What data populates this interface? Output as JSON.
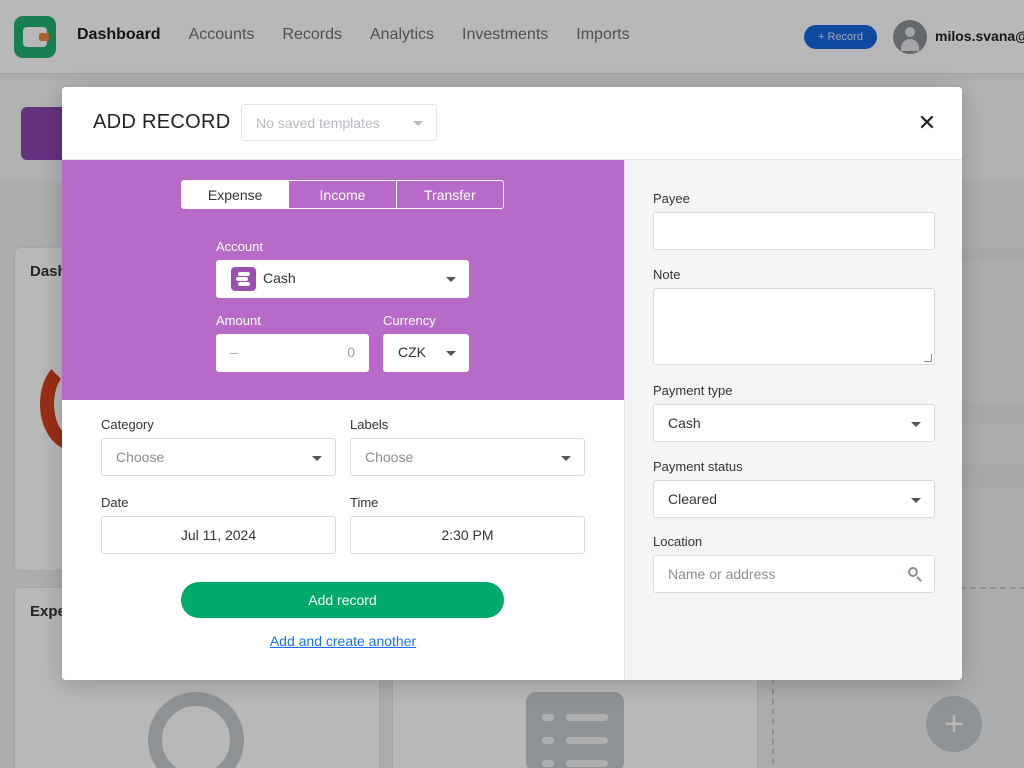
{
  "topbar": {
    "nav": [
      "Dashboard",
      "Accounts",
      "Records",
      "Analytics",
      "Investments",
      "Imports"
    ],
    "record_button": "+ Record",
    "username": "milos.svana@"
  },
  "background": {
    "card1_title": "Dash",
    "card2_title": "Expe"
  },
  "modal": {
    "title": "ADD RECORD",
    "templates_placeholder": "No saved templates",
    "close_label": "✕",
    "tabs": [
      {
        "label": "Expense",
        "active": true
      },
      {
        "label": "Income",
        "active": false
      },
      {
        "label": "Transfer",
        "active": false
      }
    ],
    "account": {
      "label": "Account",
      "value": "Cash",
      "icon": "coins-icon",
      "icon_color": "#9c4fb2"
    },
    "amount": {
      "label": "Amount",
      "sign": "–",
      "placeholder": "0"
    },
    "currency": {
      "label": "Currency",
      "value": "CZK"
    },
    "category": {
      "label": "Category",
      "placeholder": "Choose"
    },
    "labels": {
      "label": "Labels",
      "placeholder": "Choose"
    },
    "date": {
      "label": "Date",
      "value": "Jul 11, 2024"
    },
    "time": {
      "label": "Time",
      "value": "2:30 PM"
    },
    "add_button": "Add record",
    "add_another_link": "Add and create another",
    "payee": {
      "label": "Payee",
      "value": ""
    },
    "note": {
      "label": "Note",
      "value": ""
    },
    "payment_type": {
      "label": "Payment type",
      "value": "Cash"
    },
    "payment_status": {
      "label": "Payment status",
      "value": "Cleared"
    },
    "location": {
      "label": "Location",
      "placeholder": "Name or address"
    }
  },
  "colors": {
    "expense_header": "#b86ac8",
    "primary_button": "#00aa6a",
    "link": "#1a73e8",
    "brand": "#22b070"
  }
}
